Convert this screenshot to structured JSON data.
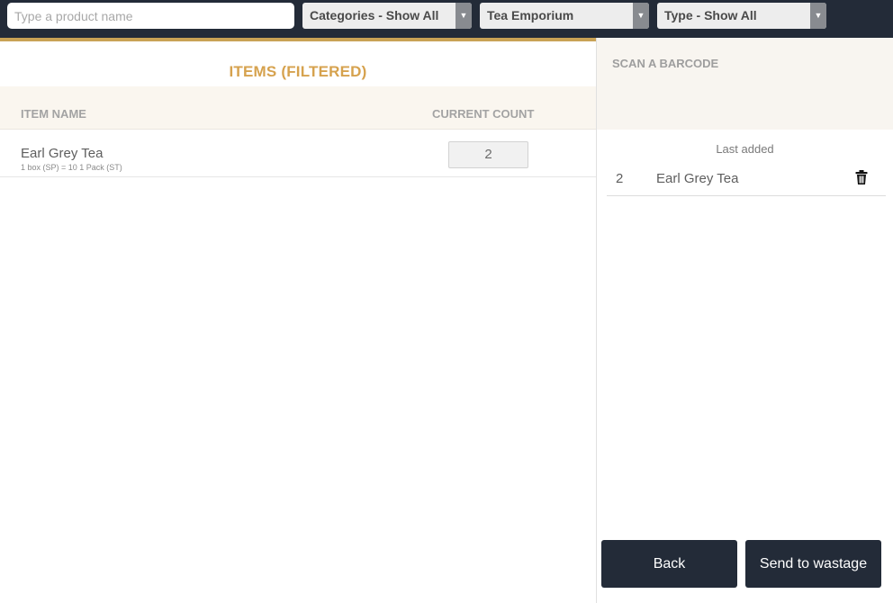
{
  "topbar": {
    "search_placeholder": "Type a product name",
    "categories_filter": "Categories - Show All",
    "store_filter": "Tea Emporium",
    "type_filter": "Type - Show All"
  },
  "items_panel": {
    "title": "ITEMS (FILTERED)",
    "columns": {
      "name": "ITEM NAME",
      "count": "CURRENT COUNT"
    },
    "rows": [
      {
        "name": "Earl Grey Tea",
        "unit_info": "1 box (SP) = 10 1 Pack (ST)",
        "count": "2"
      }
    ]
  },
  "scan_panel": {
    "scan_label": "SCAN A BARCODE",
    "last_added_label": "Last added",
    "recent": [
      {
        "qty": "2",
        "name": "Earl Grey Tea",
        "delete_icon": "trash-icon"
      }
    ]
  },
  "actions": {
    "back_label": "Back",
    "wastage_label": "Send to wastage"
  },
  "colors": {
    "navy": "#232b38",
    "gold": "#d6a24e",
    "header_bg": "#faf6ef"
  }
}
